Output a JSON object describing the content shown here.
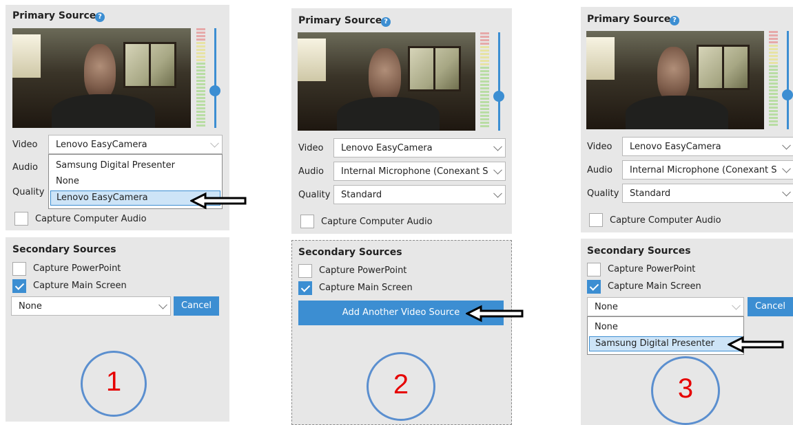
{
  "colors": {
    "accent": "#3c8ed2",
    "panel_bg": "#e7e7e7",
    "callout_number": "#e60000",
    "callout_circle": "#5b8fcf"
  },
  "icons": {
    "help": "question-circle-icon",
    "pointer": "left-arrow-icon",
    "dropdown": "chevron-down-icon"
  },
  "steps": [
    {
      "number": "1",
      "primary": {
        "title": "Primary Sources",
        "video_label": "Video",
        "video_value": "Lenovo EasyCamera",
        "audio_label": "Audio",
        "quality_label": "Quality",
        "video_dropdown_options": [
          "Samsung Digital Presenter",
          "None",
          "Lenovo EasyCamera"
        ],
        "video_dropdown_selected": "Lenovo EasyCamera",
        "capture_audio_label": "Capture Computer Audio",
        "capture_audio_checked": false
      },
      "secondary": {
        "title": "Secondary Sources",
        "powerpoint_label": "Capture PowerPoint",
        "powerpoint_checked": false,
        "main_screen_label": "Capture Main Screen",
        "main_screen_checked": true,
        "source_value": "None",
        "cancel_label": "Cancel"
      }
    },
    {
      "number": "2",
      "primary": {
        "title": "Primary Sources",
        "video_label": "Video",
        "video_value": "Lenovo EasyCamera",
        "audio_label": "Audio",
        "audio_value": "Internal Microphone (Conexant Si",
        "quality_label": "Quality",
        "quality_value": "Standard",
        "capture_audio_label": "Capture Computer Audio",
        "capture_audio_checked": false
      },
      "secondary": {
        "title": "Secondary Sources",
        "powerpoint_label": "Capture PowerPoint",
        "powerpoint_checked": false,
        "main_screen_label": "Capture Main Screen",
        "main_screen_checked": true,
        "add_video_label": "Add Another Video Source"
      }
    },
    {
      "number": "3",
      "primary": {
        "title": "Primary Sources",
        "video_label": "Video",
        "video_value": "Lenovo EasyCamera",
        "audio_label": "Audio",
        "audio_value": "Internal Microphone (Conexant Si",
        "quality_label": "Quality",
        "quality_value": "Standard",
        "capture_audio_label": "Capture Computer Audio",
        "capture_audio_checked": false
      },
      "secondary": {
        "title": "Secondary Sources",
        "powerpoint_label": "Capture PowerPoint",
        "powerpoint_checked": false,
        "main_screen_label": "Capture Main Screen",
        "main_screen_checked": true,
        "source_value": "None",
        "source_dropdown_options": [
          "None",
          "Samsung Digital Presenter"
        ],
        "source_dropdown_selected": "Samsung Digital Presenter",
        "cancel_label": "Cancel"
      }
    }
  ]
}
